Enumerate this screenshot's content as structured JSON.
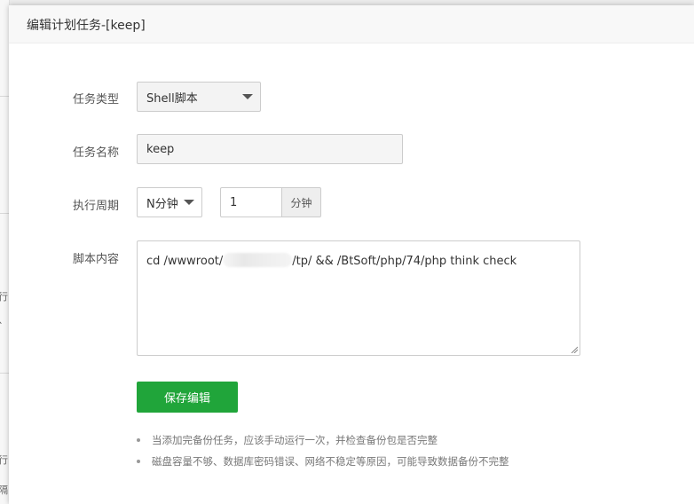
{
  "background": {
    "fragments": [
      "行",
      "、",
      "行",
      "隔"
    ]
  },
  "dialog": {
    "title": "编辑计划任务-[keep]"
  },
  "form": {
    "task_type": {
      "label": "任务类型",
      "value": "Shell脚本"
    },
    "task_name": {
      "label": "任务名称",
      "value": "keep"
    },
    "period": {
      "label": "执行周期",
      "type_value": "N分钟",
      "minutes_value": "1",
      "unit": "分钟"
    },
    "script": {
      "label": "脚本内容",
      "prefix": "cd /wwwroot/",
      "suffix": "/tp/ && /BtSoft/php/74/php think check"
    },
    "save_label": "保存编辑"
  },
  "tips": [
    "当添加完备份任务，应该手动运行一次，并检查备份包是否完整",
    "磁盘容量不够、数据库密码错误、网络不稳定等原因，可能导致数据备份不完整"
  ],
  "colors": {
    "primary": "#20a53a"
  }
}
